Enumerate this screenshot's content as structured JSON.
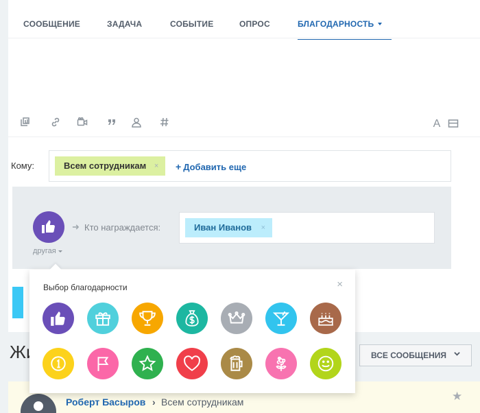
{
  "tabs": [
    {
      "label": "СООБЩЕНИЕ"
    },
    {
      "label": "ЗАДАЧА"
    },
    {
      "label": "СОБЫТИЕ"
    },
    {
      "label": "ОПРОС"
    },
    {
      "label": "БЛАГОДАРНОСТЬ"
    }
  ],
  "editor": {
    "tools": [
      "attach-file-icon",
      "link-icon",
      "video-icon",
      "quote-icon",
      "mention-icon",
      "hashtag-icon"
    ],
    "format_label": "A"
  },
  "recipients": {
    "label": "Кому:",
    "tag": "Всем сотрудникам",
    "tag_remove": "×",
    "add_more": "Добавить еще",
    "add_plus": "+"
  },
  "grat": {
    "type_label": "другая",
    "arrow": "➜",
    "who_label": "Кто награждается:",
    "employee_tag": "Иван Иванов",
    "employee_remove": "×"
  },
  "popup": {
    "title": "Выбор благодарности",
    "close": "×",
    "badges": [
      {
        "icon": "thumbs-up-icon",
        "color": "#6a4fb8"
      },
      {
        "icon": "gift-icon",
        "color": "#50d0dc"
      },
      {
        "icon": "cup-icon",
        "color": "#f7a700"
      },
      {
        "icon": "money-bag-icon",
        "color": "#1db7a1"
      },
      {
        "icon": "crown-icon",
        "color": "#a8adb4"
      },
      {
        "icon": "drink-icon",
        "color": "#32c4ee"
      },
      {
        "icon": "cake-icon",
        "color": "#a8694a"
      },
      {
        "icon": "medal-icon",
        "color": "#fcd21b"
      },
      {
        "icon": "flag-icon",
        "color": "#fb67a8"
      },
      {
        "icon": "star-icon",
        "color": "#2fb14f"
      },
      {
        "icon": "heart-icon",
        "color": "#f03f4a"
      },
      {
        "icon": "beer-icon",
        "color": "#aa8a47"
      },
      {
        "icon": "flower-icon",
        "color": "#f873b0"
      },
      {
        "icon": "smile-icon",
        "color": "#b2d51b"
      }
    ]
  },
  "feed": {
    "title": "Жи",
    "filter_label": "ВСЕ СООБЩЕНИЯ"
  },
  "post": {
    "author": "Роберт Басыров",
    "sep": "›",
    "destination": "Всем сотрудникам",
    "star": "★"
  },
  "colors": {
    "accent": "#2067b0",
    "send_button": "#3bc8f5",
    "panel_bg": "#e8ecef"
  }
}
